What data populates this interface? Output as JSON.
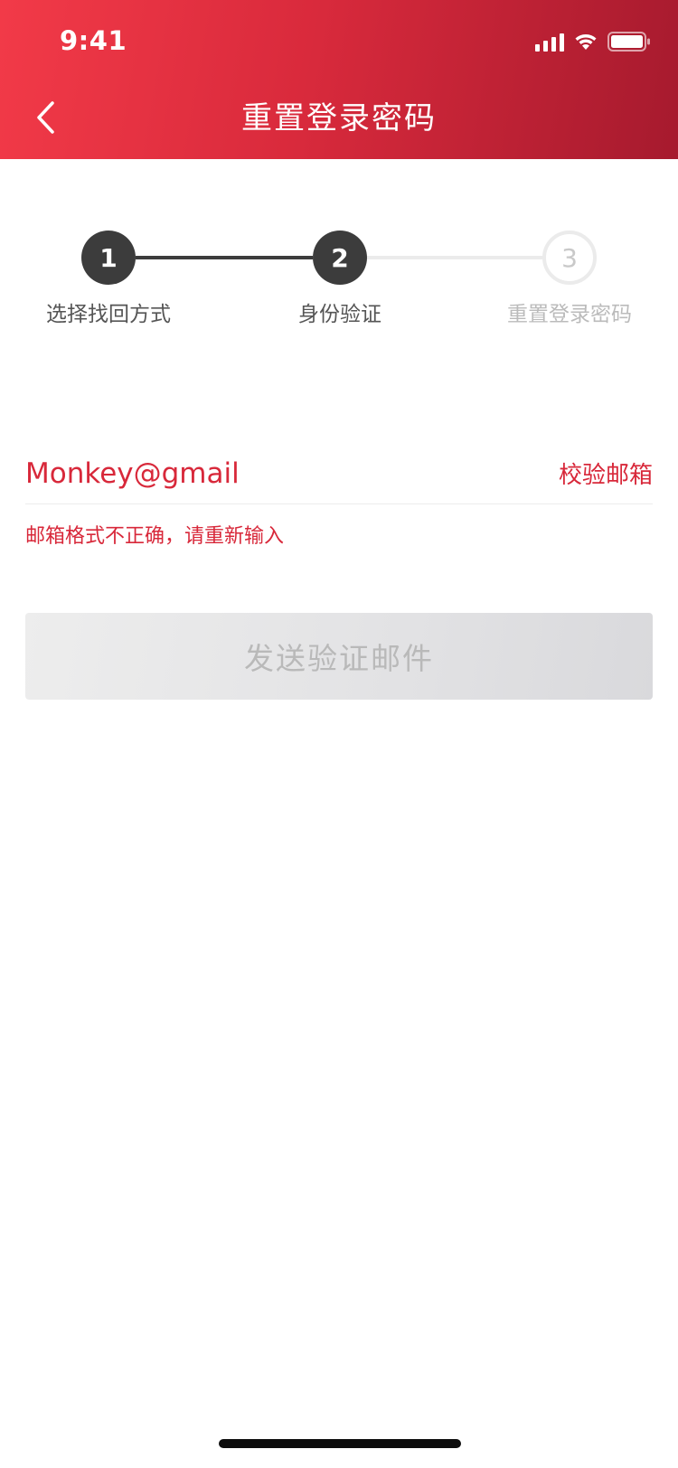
{
  "status_bar": {
    "time": "9:41"
  },
  "nav": {
    "title": "重置登录密码"
  },
  "steps": [
    {
      "number": "1",
      "label": "选择找回方式",
      "state": "done"
    },
    {
      "number": "2",
      "label": "身份验证",
      "state": "current"
    },
    {
      "number": "3",
      "label": "重置登录密码",
      "state": "todo"
    }
  ],
  "email": {
    "value": "Monkey@gmail",
    "verify_label": "校验邮箱",
    "error": "邮箱格式不正确，请重新输入"
  },
  "send_button": {
    "label": "发送验证邮件",
    "enabled": false
  },
  "colors": {
    "header_start": "#f23a48",
    "header_end": "#a61a2e",
    "accent_red": "#d8283a",
    "step_active": "#3c3c3c",
    "step_inactive": "#ebebeb",
    "button_disabled_text": "#b9b9b9"
  }
}
